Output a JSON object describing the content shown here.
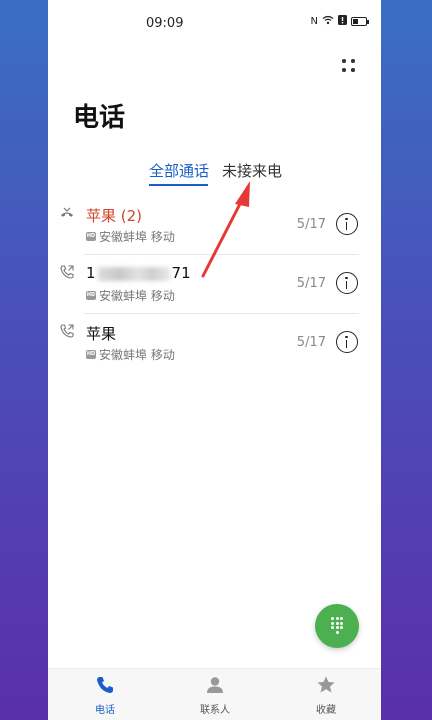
{
  "status_bar": {
    "time": "09:09"
  },
  "header": {
    "title": "电话"
  },
  "tabs": [
    {
      "label": "全部通话",
      "active": true
    },
    {
      "label": "未接来电",
      "active": false
    }
  ],
  "calls": [
    {
      "name": "苹果 (2)",
      "type": "missed",
      "carrier": "安徽蚌埠 移动",
      "date": "5/17"
    },
    {
      "name_prefix": "1",
      "name_suffix": "71",
      "type": "outgoing",
      "carrier": "安徽蚌埠 移动",
      "date": "5/17"
    },
    {
      "name": "苹果",
      "type": "outgoing",
      "carrier": "安徽蚌埠 移动",
      "date": "5/17"
    }
  ],
  "hd_badge": "HD",
  "bottom_nav": [
    {
      "label": "电话",
      "active": true
    },
    {
      "label": "联系人",
      "active": false
    },
    {
      "label": "收藏",
      "active": false
    }
  ],
  "colors": {
    "accent": "#1a5fc8",
    "missed": "#d0452c",
    "fab": "#4caf50",
    "annotation_arrow": "#e53935"
  }
}
